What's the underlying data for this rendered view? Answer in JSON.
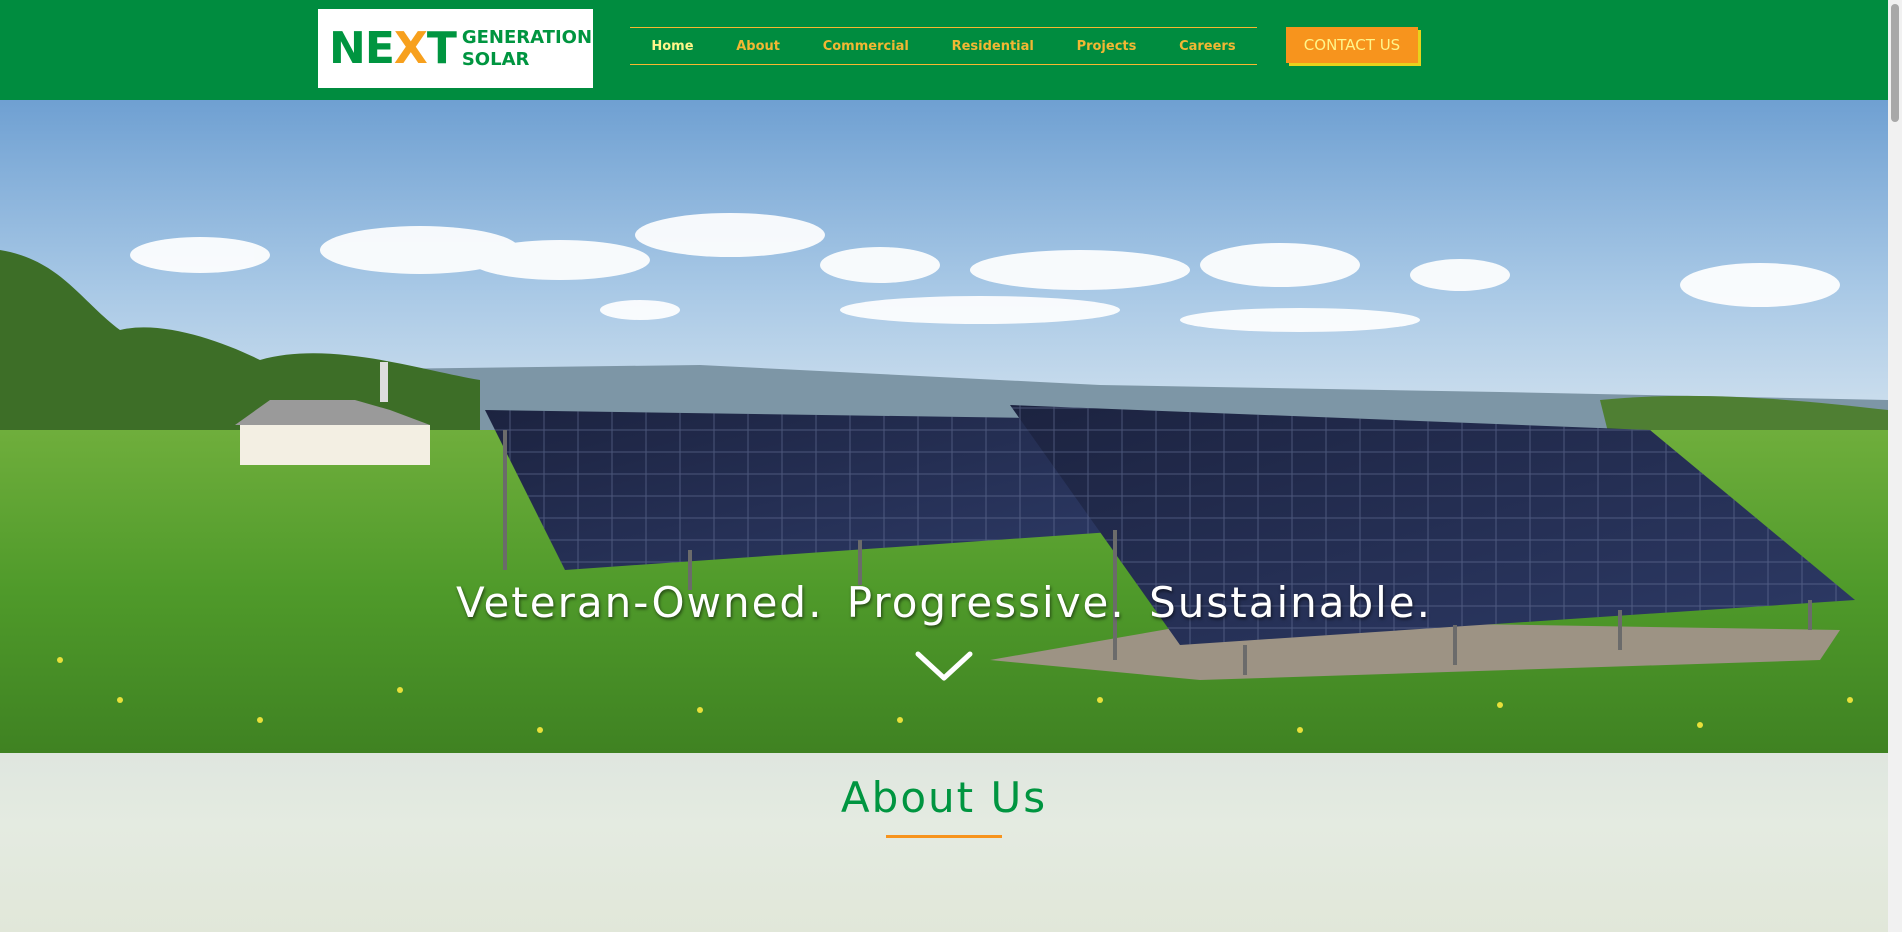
{
  "header": {
    "logo": {
      "word": "NEXT",
      "line1": "GENERATION",
      "line2": "SOLAR"
    },
    "nav": [
      {
        "label": "Home",
        "active": true
      },
      {
        "label": "About"
      },
      {
        "label": "Commercial"
      },
      {
        "label": "Residential"
      },
      {
        "label": "Projects"
      },
      {
        "label": "Careers"
      }
    ],
    "contact_label": "CONTACT US"
  },
  "hero": {
    "tagline": "Veteran-Owned.  Progressive.  Sustainable.",
    "scroll_icon": "chevron-down-icon"
  },
  "about": {
    "title": "About Us"
  },
  "colors": {
    "brand_green": "#008c3f",
    "accent_orange": "#f7941d",
    "nav_gold": "#f2b733",
    "active_nav": "#fff58a"
  }
}
